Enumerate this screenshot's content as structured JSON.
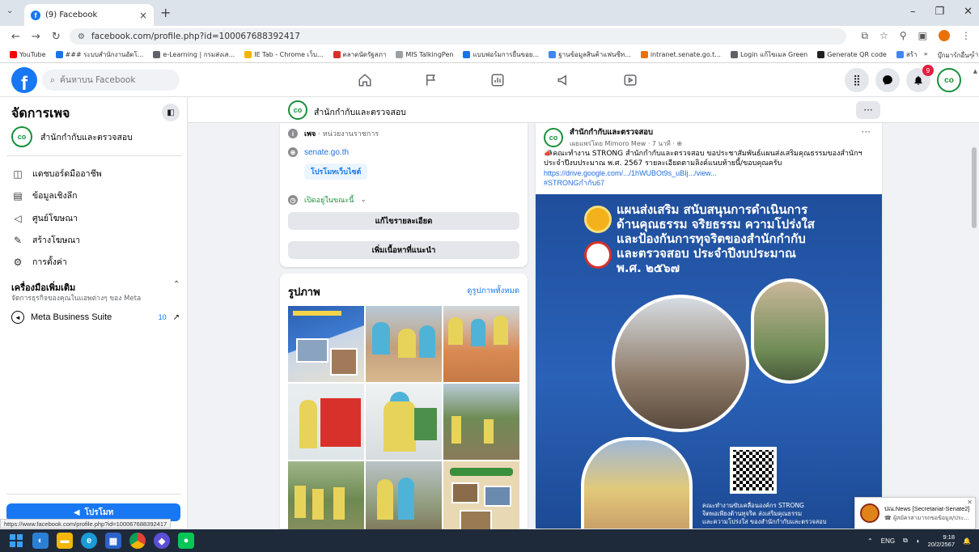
{
  "browser": {
    "tab_title": "(9) Facebook",
    "url": "facebook.com/profile.php?id=100067688392417",
    "bookmarks": [
      "YouTube",
      "### ระบบสำนักงานอัตโ...",
      "e-Learning | กรมส่งเส...",
      "IE Tab - Chrome เว็บ...",
      "ตลาดนัดรัฐสภา",
      "MIS TalkingPen",
      "แบบฟอร์มการยื่นขอย...",
      "ฐานข้อมูลสินค้าแฟนซีท...",
      "intranet.senate.go.t...",
      "Login แก้ไขเมล Green",
      "Generate QR code",
      "สร้างคิวอาร์ QR ฟรี | สร้า..."
    ],
    "bookmarks_more": "»",
    "other_bookmarks": "บุ๊กมาร์กอื่นๆ"
  },
  "fb": {
    "search_placeholder": "ค้นหาบน Facebook",
    "notif_count": "9"
  },
  "sidebar": {
    "title": "จัดการเพจ",
    "page_name": "สำนักกำกับและตรวจสอบ",
    "items": [
      {
        "label": "แดชบอร์ดมืออาชีพ",
        "icon": "dashboard-icon"
      },
      {
        "label": "ข้อมูลเชิงลึก",
        "icon": "insights-icon"
      },
      {
        "label": "ศูนย์โฆษณา",
        "icon": "megaphone-icon"
      },
      {
        "label": "สร้างโฆษณา",
        "icon": "pencil-icon"
      },
      {
        "label": "การตั้งค่า",
        "icon": "gear-icon"
      }
    ],
    "tools_title": "เครื่องมือเพิ่มเติม",
    "tools_sub": "จัดการธุรกิจของคุณในแอพต่างๆ ของ Meta",
    "mbs_label": "Meta Business Suite",
    "mbs_count": "10",
    "promote_label": "โปรโมท",
    "status_url": "https://www.facebook.com/profile.php?id=100067688392417"
  },
  "page_strip": {
    "name": "สำนักกำกับและตรวจสอบ",
    "more": "···"
  },
  "intro": {
    "category_bold": "เพจ",
    "category": " · หน่วยงานราชการ",
    "website": "senate.go.th",
    "promote_site": "โปรโมทเว็บไซต์",
    "open_status": "เปิดอยู่ในขณะนี้",
    "edit_details": "แก้ไขรายละเอียด",
    "add_featured": "เพิ่มเนื้อหาที่แนะนำ"
  },
  "photos": {
    "title": "รูปภาพ",
    "see_all": "ดูรูปภาพทั้งหมด"
  },
  "post": {
    "author": "สำนักกำกับและตรวจสอบ",
    "meta": "เผยแพร่โดย Mimoro Mew · 7 นาที · ",
    "text_line1": "📣คณะทำงาน STRONG สำนักกำกับและตรวจสอบ ขอประชาสัมพันธ์แผนส่งเสริมคุณธรรมของสำนักฯ",
    "text_line2": "ประจำปีงบประมาณ พ.ศ. 2567 รายละเอียดตามลิงค์แนบท้ายนี้/ขอบคุณครับ",
    "link": "https://drive.google.com/.../1hWUBOt9s_uBIj.../view...",
    "hashtag": "#STRONGกำกับ67",
    "poster_line1": "แผนส่งเสริม สนับสนุนการดำเนินการ",
    "poster_line2": "ด้านคุณธรรม จริยธรรม ความโปร่งใส",
    "poster_line3": "และป้องกันการทุจริตของสำนักกำกับ",
    "poster_line4": "และตรวจสอบ ประจำปีงบประมาณ",
    "poster_line5": "พ.ศ. ๒๕๖๗",
    "poster_foot1": "คณะทำงานขับเคลื่อนองค์กร STRONG",
    "poster_foot2": "จิตพอเพียงต้านทุจริต ส่งเสริมคุณธรรม",
    "poster_foot3": "และความโปร่งใส ของสำนักกำกับและตรวจสอบ"
  },
  "toast": {
    "title": "ปณ.News [Secretariat-Senate2]",
    "body": "☎ ผู้สมัครสามารถขอข้อมูล/ประ..."
  },
  "taskbar": {
    "lang": "ENG",
    "time": "9:18",
    "date": "20/2/2567"
  },
  "colors": {
    "fb_blue": "#1877f2",
    "page_green": "#1a8f3c",
    "poster_blue": "#1f4e9c"
  }
}
